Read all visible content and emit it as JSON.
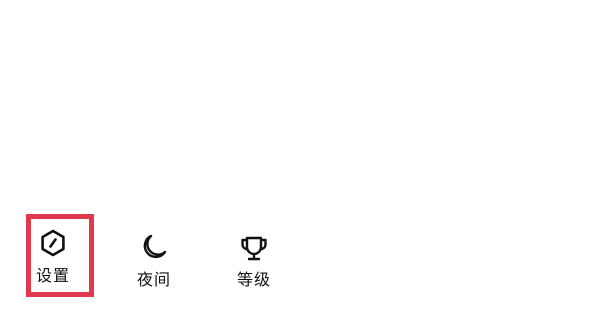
{
  "toolbar": {
    "items": [
      {
        "label": "设置",
        "icon": "settings-hexagon-icon"
      },
      {
        "label": "夜间",
        "icon": "moon-icon"
      },
      {
        "label": "等级",
        "icon": "trophy-icon"
      }
    ]
  },
  "highlight": {
    "color": "#e0384c",
    "target": "设置"
  }
}
